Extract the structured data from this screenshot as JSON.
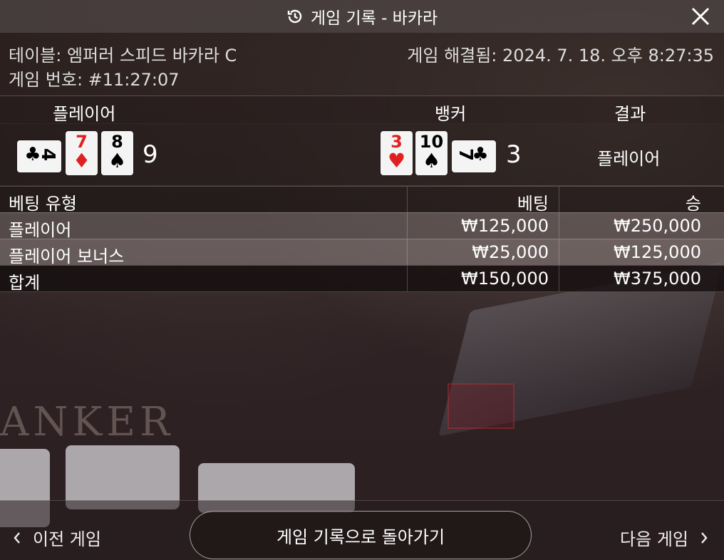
{
  "window": {
    "title": "게임 기록 - 바카라"
  },
  "info": {
    "table": "테이블: 엠퍼러 스피드 바카라 C",
    "game_number": "게임 번호: #11:27:07",
    "resolved": "게임 해결됨: 2024. 7. 18. 오후 8:27:35"
  },
  "headers": {
    "player": "플레이어",
    "banker": "뱅커",
    "result": "결과"
  },
  "player_hand": {
    "cards": [
      {
        "rank": "4",
        "suit": "♣",
        "color": "#000000",
        "orientation": "sideways"
      },
      {
        "rank": "7",
        "suit": "♦",
        "color": "#e02020",
        "orientation": "upright"
      },
      {
        "rank": "8",
        "suit": "♠",
        "color": "#000000",
        "orientation": "upright"
      }
    ],
    "score": "9"
  },
  "banker_hand": {
    "cards": [
      {
        "rank": "3",
        "suit": "♥",
        "color": "#e02020",
        "orientation": "upright"
      },
      {
        "rank": "10",
        "suit": "♠",
        "color": "#000000",
        "orientation": "upright"
      },
      {
        "rank": "7",
        "suit": "♣",
        "color": "#000000",
        "orientation": "sideways"
      }
    ],
    "score": "3"
  },
  "result": "플레이어",
  "bets": {
    "columns": [
      "베팅 유형",
      "베팅",
      "승"
    ],
    "rows": [
      [
        "플레이어",
        "₩125,000",
        "₩250,000"
      ],
      [
        "플레이어 보너스",
        "₩25,000",
        "₩125,000"
      ]
    ],
    "total": [
      "합계",
      "₩150,000",
      "₩375,000"
    ]
  },
  "background_text": "ANKER",
  "footer": {
    "prev": "이전 게임",
    "back": "게임 기록으로 돌아가기",
    "next": "다음 게임"
  }
}
